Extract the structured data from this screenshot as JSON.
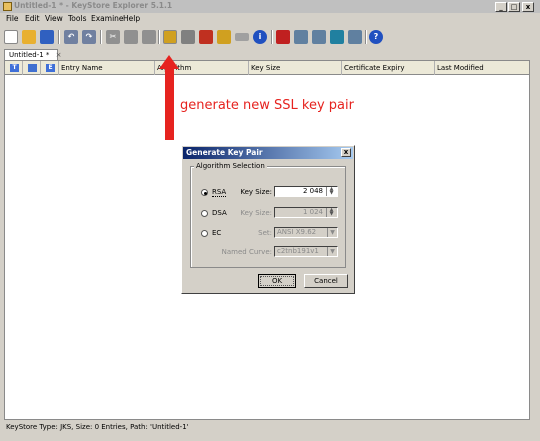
{
  "window": {
    "title": "Untitled-1 * - KeyStore Explorer 5.1.1",
    "controls": [
      "_",
      "□",
      "x"
    ]
  },
  "menu": [
    "File",
    "Edit",
    "View",
    "Tools",
    "Examine",
    "Help"
  ],
  "toolbar": [
    {
      "icon": "new-keystore-icon",
      "color": "#ffffff"
    },
    {
      "icon": "open-keystore-icon",
      "color": "#e8b030"
    },
    {
      "icon": "save-icon",
      "color": "#3060c0"
    },
    {
      "icon": "undo-icon",
      "color": "#7080a0"
    },
    {
      "icon": "redo-icon",
      "color": "#7080a0"
    },
    {
      "icon": "cut-icon",
      "color": "#909090"
    },
    {
      "icon": "copy-icon",
      "color": "#909090"
    },
    {
      "icon": "paste-icon",
      "color": "#909090"
    },
    {
      "icon": "generate-key-pair-icon",
      "color": "#d0a020"
    },
    {
      "icon": "generate-secret-key-icon",
      "color": "#808080"
    },
    {
      "icon": "import-trusted-certificate-icon",
      "color": "#c03020"
    },
    {
      "icon": "import-key-pair-icon",
      "color": "#d0a020"
    },
    {
      "icon": "set-password-icon",
      "color": "#a0a0a0"
    },
    {
      "icon": "properties-icon",
      "color": "#2050c0"
    },
    {
      "icon": "examine-certificate-icon",
      "color": "#c02020"
    },
    {
      "icon": "examine-crl-icon",
      "color": "#6080a0"
    },
    {
      "icon": "examine-csr-icon",
      "color": "#6080a0"
    },
    {
      "icon": "examine-clipboard-icon",
      "color": "#2080a0"
    },
    {
      "icon": "examine-file-icon",
      "color": "#6080a0"
    },
    {
      "icon": "help-icon",
      "color": "#2050c0"
    }
  ],
  "tab": {
    "label": "Untitled-1 *",
    "close": "×"
  },
  "table": {
    "type_icons": [
      "T",
      "🔒",
      "E"
    ],
    "columns": [
      "Entry Name",
      "Algorithm",
      "Key Size",
      "Certificate Expiry",
      "Last Modified"
    ]
  },
  "annotation": "generate new SSL key pair",
  "dialog": {
    "title": "Generate Key Pair",
    "close": "x",
    "group_label": "Algorithm Selection",
    "options": [
      {
        "label": "RSA",
        "selected": true
      },
      {
        "label": "DSA",
        "selected": false
      },
      {
        "label": "EC",
        "selected": false
      }
    ],
    "rsa_key_size_label": "Key Size:",
    "rsa_key_size": "2 048",
    "dsa_key_size_label": "Key Size:",
    "dsa_key_size": "1 024",
    "ec_set_label": "Set:",
    "ec_set": "ANSI X9.62",
    "named_curve_label": "Named Curve:",
    "named_curve": "c2tnb191v1",
    "ok": "OK",
    "cancel": "Cancel"
  },
  "status": "KeyStore Type: JKS, Size: 0 Entries, Path: 'Untitled-1'"
}
